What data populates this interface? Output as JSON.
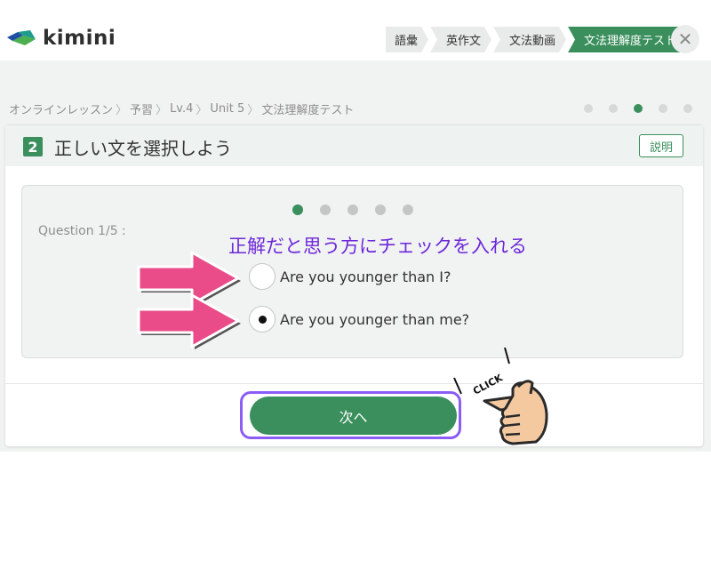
{
  "header": {
    "logo_text": "kimini",
    "nav_tabs": [
      {
        "label": "語彙"
      },
      {
        "label": "英作文"
      },
      {
        "label": "文法動画"
      },
      {
        "label": "文法理解度テスト",
        "active": true
      }
    ],
    "close_symbol": "✕"
  },
  "breadcrumb": {
    "items": [
      "オンラインレッスン",
      "予習",
      "Lv.4",
      "Unit 5",
      "文法理解度テスト"
    ],
    "separator": "〉"
  },
  "section_progress": {
    "total": 5,
    "current": 3
  },
  "card": {
    "number": "2",
    "title": "正しい文を選択しよう",
    "explain_label": "説明"
  },
  "question": {
    "counter": "Question 1/5 :",
    "dots_total": 5,
    "dots_current": 1,
    "options": [
      {
        "text": "Are you younger than I?",
        "selected": false
      },
      {
        "text": "Are you younger than me?",
        "selected": true
      }
    ]
  },
  "next_label": "次へ",
  "annotation": {
    "instruction": "正解だと思う方にチェックを入れる",
    "click_label": "CLICK",
    "colors": {
      "instruction": "#6d28d9",
      "arrow": "#ea4c89",
      "outline": "#8b5cf6"
    }
  },
  "colors": {
    "accent": "#3a8f5c",
    "background": "#f1f3f2"
  }
}
